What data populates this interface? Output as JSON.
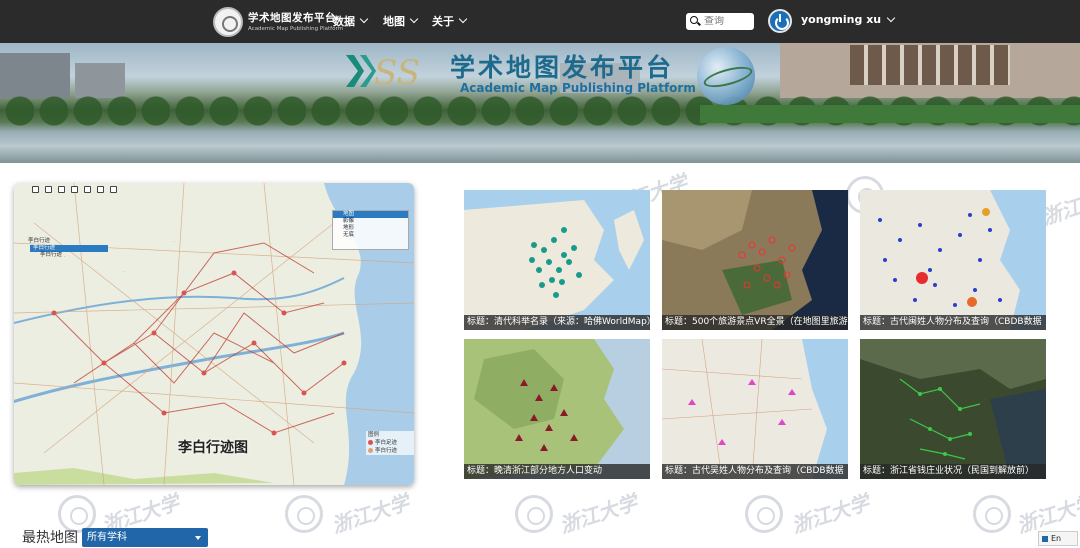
{
  "nav": {
    "brand_title": "学术地图发布平台",
    "brand_subtitle": "Academic Map Publishing Platform",
    "items": [
      {
        "label": "数据"
      },
      {
        "label": "地图"
      },
      {
        "label": "关于"
      }
    ],
    "search_placeholder": "查询",
    "user_name": "yongming xu"
  },
  "banner": {
    "logo_text": "SS",
    "title": "学术地图发布平台",
    "subtitle": "Academic Map Publishing Platform"
  },
  "featured_map": {
    "title": "李白行迹图",
    "layer_tree": [
      "李白行迹",
      "李白行迹",
      "李白行迹"
    ],
    "base_layers": [
      "地图",
      "影像",
      "地形",
      "无底"
    ],
    "legend_title": "图例",
    "legend_items": [
      {
        "label": "李白足迹",
        "color": "#d9534f"
      },
      {
        "label": "李白行迹",
        "color": "#e0a070"
      }
    ]
  },
  "cards": [
    {
      "caption": "标题：清代科举名录（来源：哈佛WorldMap）"
    },
    {
      "caption": "标题：500个旅游景点VR全景（在地图里旅游"
    },
    {
      "caption": "标题：古代闽姓人物分布及查询（CBDB数据"
    },
    {
      "caption": "标题：晚清浙江部分地方人口变动"
    },
    {
      "caption": "标题：古代吴姓人物分布及查询（CBDB数据"
    },
    {
      "caption": "标题：浙江省钱庄业状况（民国到解放前）"
    }
  ],
  "watermark_text": "浙江大学",
  "hot_maps_label": "最热地图",
  "subject_select_value": "所有学科",
  "lang_label": "En",
  "colors": {
    "nav_bg": "#2b2b2b",
    "select_bg": "#2166a8",
    "accent": "#1a6fb8"
  }
}
